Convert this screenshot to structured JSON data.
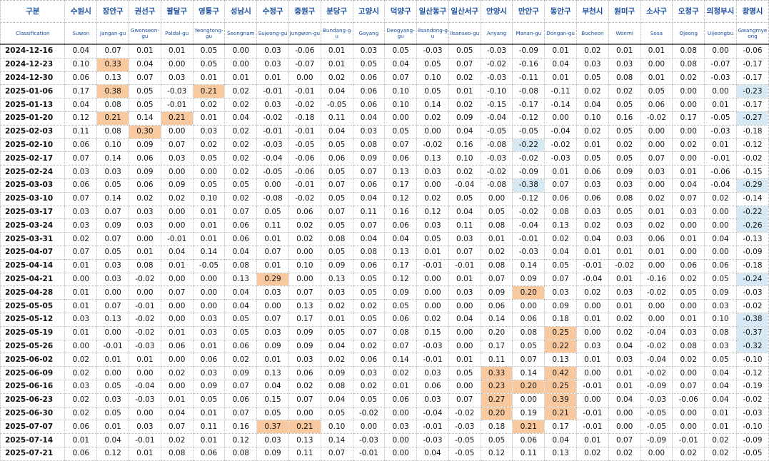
{
  "columns": [
    {
      "kor": "구분",
      "eng": "Classification"
    },
    {
      "kor": "수원시",
      "eng": "Suwon"
    },
    {
      "kor": "장안구",
      "eng": "Jangan-gu"
    },
    {
      "kor": "권선구",
      "eng": "Gwonseon-gu"
    },
    {
      "kor": "팔달구",
      "eng": "Paldal-gu"
    },
    {
      "kor": "영통구",
      "eng": "Yeongtong-gu"
    },
    {
      "kor": "성남시",
      "eng": "Seongnam"
    },
    {
      "kor": "수정구",
      "eng": "Sujeong-gu"
    },
    {
      "kor": "중원구",
      "eng": "Jungwon-gu"
    },
    {
      "kor": "분당구",
      "eng": "Bundang-gu"
    },
    {
      "kor": "고양시",
      "eng": "Goyang"
    },
    {
      "kor": "덕양구",
      "eng": "Deogyang-gu"
    },
    {
      "kor": "일산동구",
      "eng": "Ilsandong-gu"
    },
    {
      "kor": "일산서구",
      "eng": "Ilsanseo-gu"
    },
    {
      "kor": "안양시",
      "eng": "Anyang"
    },
    {
      "kor": "만안구",
      "eng": "Manan-gu"
    },
    {
      "kor": "동안구",
      "eng": "Dongan-gu"
    },
    {
      "kor": "부천시",
      "eng": "Bucheon"
    },
    {
      "kor": "원미구",
      "eng": "Wonmi"
    },
    {
      "kor": "소사구",
      "eng": "Sosa"
    },
    {
      "kor": "오정구",
      "eng": "Ojeong"
    },
    {
      "kor": "의정부시",
      "eng": "Uijeongbu"
    },
    {
      "kor": "광명시",
      "eng": "Gwangmyeong"
    }
  ],
  "colors": {
    "highlight_orange": "#f8c89e",
    "highlight_blue": "#d6e9f5",
    "header_text": "#1a4ea1"
  },
  "rows": [
    {
      "date": "2024-12-16",
      "values": [
        "0.04",
        "0.07",
        "0.01",
        "0.01",
        "0.05",
        "0.00",
        "0.03",
        "-0.06",
        "0.01",
        "0.03",
        "0.05",
        "-0.03",
        "0.05",
        "-0.03",
        "-0.09",
        "0.01",
        "0.02",
        "0.01",
        "0.01",
        "0.08",
        "0.00",
        "-0.06"
      ],
      "orange": [],
      "blue": []
    },
    {
      "date": "2024-12-23",
      "values": [
        "0.10",
        "0.33",
        "0.04",
        "0.00",
        "0.05",
        "0.00",
        "0.03",
        "-0.07",
        "0.01",
        "0.05",
        "0.04",
        "0.05",
        "0.07",
        "-0.02",
        "-0.16",
        "0.04",
        "0.03",
        "0.03",
        "0.00",
        "0.08",
        "-0.07",
        "-0.17"
      ],
      "orange": [
        1
      ],
      "blue": []
    },
    {
      "date": "2024-12-30",
      "values": [
        "0.06",
        "0.13",
        "0.07",
        "0.03",
        "0.01",
        "0.01",
        "0.01",
        "0.00",
        "0.02",
        "0.06",
        "0.07",
        "0.10",
        "0.02",
        "-0.03",
        "-0.11",
        "0.01",
        "0.05",
        "0.08",
        "0.01",
        "0.02",
        "-0.03",
        "-0.17"
      ],
      "orange": [],
      "blue": []
    },
    {
      "date": "2025-01-06",
      "values": [
        "0.17",
        "0.38",
        "0.05",
        "-0.03",
        "0.21",
        "0.02",
        "-0.01",
        "-0.01",
        "0.04",
        "0.06",
        "0.10",
        "0.05",
        "0.01",
        "-0.10",
        "-0.08",
        "-0.11",
        "0.02",
        "0.02",
        "0.05",
        "0.00",
        "0.00",
        "-0.23"
      ],
      "orange": [
        1,
        4
      ],
      "blue": [
        21
      ]
    },
    {
      "date": "2025-01-13",
      "values": [
        "0.04",
        "0.08",
        "0.05",
        "-0.01",
        "0.02",
        "0.02",
        "0.03",
        "-0.02",
        "-0.05",
        "0.06",
        "0.10",
        "0.14",
        "0.02",
        "-0.15",
        "-0.17",
        "-0.14",
        "0.04",
        "0.05",
        "0.06",
        "0.00",
        "0.01",
        "-0.17"
      ],
      "orange": [],
      "blue": []
    },
    {
      "date": "2025-01-20",
      "values": [
        "0.12",
        "0.21",
        "0.14",
        "0.21",
        "0.01",
        "0.04",
        "-0.02",
        "-0.18",
        "0.11",
        "0.04",
        "0.00",
        "0.02",
        "0.09",
        "-0.04",
        "-0.12",
        "0.00",
        "0.10",
        "0.16",
        "-0.02",
        "0.17",
        "-0.05",
        "-0.27"
      ],
      "orange": [
        1,
        3
      ],
      "blue": [
        21
      ]
    },
    {
      "date": "2025-02-03",
      "values": [
        "0.11",
        "0.08",
        "0.30",
        "0.00",
        "0.03",
        "0.02",
        "-0.01",
        "-0.01",
        "0.04",
        "0.03",
        "0.05",
        "0.00",
        "0.04",
        "-0.05",
        "-0.05",
        "-0.04",
        "0.02",
        "0.05",
        "0.00",
        "0.00",
        "-0.03",
        "-0.18"
      ],
      "orange": [
        2
      ],
      "blue": []
    },
    {
      "date": "2025-02-10",
      "values": [
        "0.06",
        "0.10",
        "0.09",
        "0.07",
        "0.02",
        "0.02",
        "-0.03",
        "-0.05",
        "0.05",
        "0.08",
        "0.07",
        "-0.02",
        "0.16",
        "-0.08",
        "-0.22",
        "-0.02",
        "0.01",
        "0.02",
        "0.00",
        "0.02",
        "0.01",
        "-0.12"
      ],
      "orange": [],
      "blue": [
        14
      ]
    },
    {
      "date": "2025-02-17",
      "values": [
        "0.07",
        "0.14",
        "0.06",
        "0.03",
        "0.05",
        "0.02",
        "-0.04",
        "-0.06",
        "0.06",
        "0.09",
        "0.06",
        "0.13",
        "0.10",
        "-0.03",
        "-0.02",
        "-0.03",
        "0.05",
        "0.05",
        "0.07",
        "0.00",
        "-0.01",
        "-0.02"
      ],
      "orange": [],
      "blue": []
    },
    {
      "date": "2025-02-24",
      "values": [
        "0.03",
        "0.03",
        "0.09",
        "0.00",
        "0.00",
        "0.02",
        "-0.05",
        "-0.06",
        "0.05",
        "0.07",
        "0.13",
        "0.03",
        "0.02",
        "-0.02",
        "-0.09",
        "0.01",
        "0.06",
        "0.09",
        "0.03",
        "0.01",
        "-0.06",
        "-0.15"
      ],
      "orange": [],
      "blue": []
    },
    {
      "date": "2025-03-03",
      "values": [
        "0.06",
        "0.05",
        "0.06",
        "0.09",
        "0.05",
        "0.05",
        "0.00",
        "-0.01",
        "0.07",
        "0.06",
        "0.17",
        "0.00",
        "-0.04",
        "-0.08",
        "-0.38",
        "0.07",
        "0.03",
        "0.03",
        "0.00",
        "0.04",
        "-0.04",
        "-0.29"
      ],
      "orange": [],
      "blue": [
        14,
        21
      ]
    },
    {
      "date": "2025-03-10",
      "values": [
        "0.07",
        "0.14",
        "0.02",
        "0.02",
        "0.10",
        "0.02",
        "-0.08",
        "-0.02",
        "0.05",
        "0.04",
        "0.12",
        "0.02",
        "0.05",
        "0.00",
        "-0.12",
        "0.06",
        "0.06",
        "0.08",
        "0.02",
        "0.07",
        "0.02",
        "-0.14"
      ],
      "orange": [],
      "blue": []
    },
    {
      "date": "2025-03-17",
      "values": [
        "0.03",
        "0.07",
        "0.03",
        "0.00",
        "0.01",
        "0.07",
        "0.05",
        "0.06",
        "0.07",
        "0.11",
        "0.16",
        "0.12",
        "0.04",
        "0.05",
        "-0.02",
        "0.08",
        "0.03",
        "0.05",
        "0.01",
        "0.03",
        "0.00",
        "-0.22"
      ],
      "orange": [],
      "blue": [
        21
      ]
    },
    {
      "date": "2025-03-24",
      "values": [
        "0.03",
        "0.09",
        "0.03",
        "0.00",
        "0.01",
        "0.06",
        "0.11",
        "0.02",
        "0.05",
        "0.07",
        "0.06",
        "0.03",
        "0.11",
        "0.08",
        "-0.04",
        "0.13",
        "0.02",
        "0.03",
        "0.02",
        "0.00",
        "0.00",
        "-0.26"
      ],
      "orange": [],
      "blue": [
        21
      ]
    },
    {
      "date": "2025-03-31",
      "values": [
        "0.02",
        "0.07",
        "0.00",
        "-0.01",
        "0.01",
        "0.06",
        "0.01",
        "0.02",
        "0.08",
        "0.04",
        "0.04",
        "0.05",
        "0.03",
        "0.01",
        "-0.01",
        "0.02",
        "0.04",
        "0.03",
        "0.06",
        "0.01",
        "0.04",
        "-0.13"
      ],
      "orange": [],
      "blue": []
    },
    {
      "date": "2025-04-07",
      "values": [
        "0.07",
        "0.05",
        "0.01",
        "0.04",
        "0.14",
        "0.04",
        "0.07",
        "0.00",
        "0.05",
        "0.08",
        "0.13",
        "0.01",
        "0.07",
        "0.02",
        "-0.03",
        "0.04",
        "0.01",
        "0.01",
        "0.01",
        "0.00",
        "0.00",
        "-0.09"
      ],
      "orange": [],
      "blue": []
    },
    {
      "date": "2025-04-14",
      "values": [
        "0.01",
        "0.03",
        "0.08",
        "0.01",
        "-0.05",
        "0.08",
        "0.01",
        "0.10",
        "0.09",
        "0.06",
        "0.17",
        "-0.01",
        "-0.01",
        "0.08",
        "0.14",
        "0.05",
        "-0.01",
        "-0.02",
        "0.00",
        "0.06",
        "0.06",
        "-0.18"
      ],
      "orange": [],
      "blue": []
    },
    {
      "date": "2025-04-21",
      "values": [
        "0.00",
        "0.03",
        "-0.02",
        "0.00",
        "0.00",
        "0.13",
        "0.29",
        "0.00",
        "0.13",
        "0.05",
        "0.12",
        "0.00",
        "0.01",
        "0.07",
        "0.09",
        "0.07",
        "-0.04",
        "0.01",
        "-0.16",
        "0.02",
        "0.05",
        "-0.24"
      ],
      "orange": [
        6
      ],
      "blue": [
        21
      ]
    },
    {
      "date": "2025-04-28",
      "values": [
        "0.01",
        "0.00",
        "0.00",
        "0.07",
        "0.00",
        "0.04",
        "0.03",
        "0.07",
        "0.03",
        "0.05",
        "0.09",
        "0.00",
        "0.03",
        "0.09",
        "0.20",
        "0.03",
        "0.02",
        "0.03",
        "-0.02",
        "0.05",
        "0.09",
        "-0.03"
      ],
      "orange": [
        14
      ],
      "blue": []
    },
    {
      "date": "2025-05-05",
      "values": [
        "0.01",
        "0.07",
        "-0.01",
        "0.00",
        "0.00",
        "0.04",
        "0.00",
        "0.13",
        "0.02",
        "0.02",
        "0.05",
        "0.00",
        "0.00",
        "0.06",
        "0.00",
        "0.09",
        "0.00",
        "0.01",
        "0.00",
        "0.00",
        "0.03",
        "-0.02"
      ],
      "orange": [],
      "blue": []
    },
    {
      "date": "2025-05-12",
      "values": [
        "0.03",
        "0.13",
        "-0.02",
        "0.00",
        "0.03",
        "0.05",
        "0.07",
        "0.17",
        "0.01",
        "0.05",
        "0.06",
        "0.02",
        "0.04",
        "0.14",
        "0.06",
        "0.18",
        "0.01",
        "0.02",
        "0.00",
        "0.01",
        "0.10",
        "-0.38"
      ],
      "orange": [],
      "blue": [
        21
      ]
    },
    {
      "date": "2025-05-19",
      "values": [
        "0.01",
        "0.00",
        "-0.02",
        "0.01",
        "0.03",
        "0.05",
        "0.03",
        "0.09",
        "0.05",
        "0.07",
        "0.08",
        "0.15",
        "0.00",
        "0.20",
        "0.08",
        "0.25",
        "0.00",
        "0.02",
        "-0.04",
        "0.03",
        "0.08",
        "-0.37"
      ],
      "orange": [
        15
      ],
      "blue": [
        21
      ]
    },
    {
      "date": "2025-05-26",
      "values": [
        "0.00",
        "-0.01",
        "-0.03",
        "0.06",
        "0.01",
        "0.06",
        "0.09",
        "0.09",
        "0.04",
        "0.02",
        "0.07",
        "-0.03",
        "0.00",
        "0.17",
        "0.05",
        "0.22",
        "0.03",
        "0.04",
        "-0.02",
        "0.08",
        "0.03",
        "-0.32"
      ],
      "orange": [
        15
      ],
      "blue": [
        21
      ]
    },
    {
      "date": "2025-06-02",
      "values": [
        "0.02",
        "0.01",
        "0.01",
        "0.00",
        "0.06",
        "0.02",
        "0.01",
        "0.03",
        "0.02",
        "0.06",
        "0.14",
        "-0.01",
        "0.01",
        "0.11",
        "0.07",
        "0.13",
        "0.01",
        "0.03",
        "-0.04",
        "0.02",
        "0.05",
        "-0.10"
      ],
      "orange": [],
      "blue": []
    },
    {
      "date": "2025-06-09",
      "values": [
        "0.02",
        "0.00",
        "0.00",
        "0.02",
        "0.03",
        "0.09",
        "0.13",
        "0.06",
        "0.09",
        "0.03",
        "0.02",
        "0.03",
        "0.05",
        "0.33",
        "0.14",
        "0.42",
        "0.00",
        "0.01",
        "-0.02",
        "0.00",
        "0.04",
        "-0.12"
      ],
      "orange": [
        13,
        15
      ],
      "blue": []
    },
    {
      "date": "2025-06-16",
      "values": [
        "0.03",
        "0.05",
        "-0.04",
        "0.00",
        "0.09",
        "0.07",
        "0.04",
        "0.02",
        "0.08",
        "0.02",
        "0.01",
        "0.06",
        "0.00",
        "0.23",
        "0.20",
        "0.25",
        "-0.01",
        "0.01",
        "-0.09",
        "0.07",
        "0.04",
        "-0.19"
      ],
      "orange": [
        13,
        14,
        15
      ],
      "blue": []
    },
    {
      "date": "2025-06-23",
      "values": [
        "0.02",
        "0.03",
        "-0.03",
        "0.01",
        "0.05",
        "0.06",
        "0.15",
        "0.07",
        "0.04",
        "0.05",
        "0.06",
        "0.03",
        "0.07",
        "0.27",
        "0.00",
        "0.39",
        "0.00",
        "0.04",
        "-0.03",
        "-0.06",
        "0.04",
        "-0.02"
      ],
      "orange": [
        13,
        15
      ],
      "blue": []
    },
    {
      "date": "2025-06-30",
      "values": [
        "0.02",
        "0.05",
        "0.00",
        "0.04",
        "0.01",
        "0.07",
        "0.05",
        "0.00",
        "0.05",
        "-0.02",
        "0.00",
        "-0.04",
        "-0.02",
        "0.20",
        "0.19",
        "0.21",
        "-0.01",
        "0.00",
        "-0.05",
        "0.00",
        "0.01",
        "-0.03"
      ],
      "orange": [
        13,
        15
      ],
      "blue": []
    },
    {
      "date": "2025-07-07",
      "values": [
        "0.06",
        "0.01",
        "0.03",
        "0.07",
        "0.11",
        "0.16",
        "0.37",
        "0.21",
        "0.10",
        "0.00",
        "0.03",
        "-0.01",
        "-0.03",
        "0.18",
        "0.21",
        "0.17",
        "-0.01",
        "0.00",
        "-0.05",
        "0.00",
        "0.01",
        "-0.10"
      ],
      "orange": [
        6,
        7,
        14
      ],
      "blue": []
    },
    {
      "date": "2025-07-14",
      "values": [
        "0.01",
        "0.04",
        "-0.01",
        "0.02",
        "0.01",
        "0.12",
        "0.03",
        "0.13",
        "0.14",
        "-0.03",
        "0.00",
        "-0.03",
        "-0.05",
        "0.05",
        "0.06",
        "0.04",
        "0.01",
        "0.07",
        "-0.09",
        "-0.01",
        "0.02",
        "-0.09"
      ],
      "orange": [],
      "blue": []
    },
    {
      "date": "2025-07-21",
      "values": [
        "0.06",
        "0.12",
        "0.01",
        "0.08",
        "0.06",
        "0.08",
        "0.09",
        "0.11",
        "0.07",
        "-0.01",
        "0.00",
        "0.04",
        "-0.05",
        "0.12",
        "0.11",
        "0.13",
        "0.02",
        "0.02",
        "0.00",
        "0.02",
        "0.02",
        "-0.05"
      ],
      "orange": [],
      "blue": []
    }
  ]
}
